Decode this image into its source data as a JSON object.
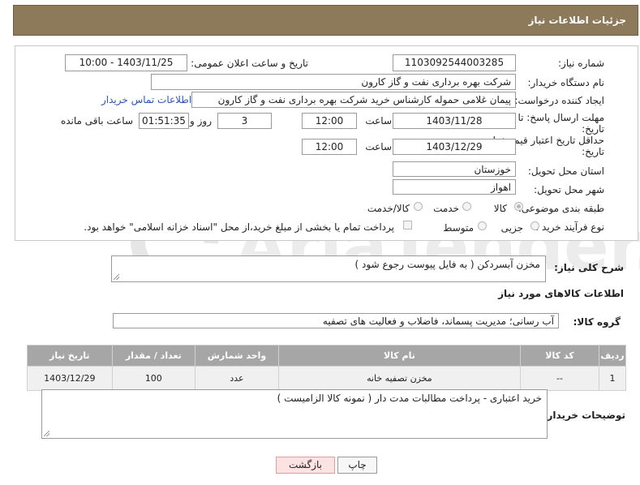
{
  "header": {
    "title": "جزئیات اطلاعات نیاز"
  },
  "form": {
    "need_number": {
      "label": "شماره نیاز:",
      "value": "1103092544003285"
    },
    "announce_datetime": {
      "label": "تاریخ و ساعت اعلان عمومی:",
      "value": "1403/11/25 - 10:00"
    },
    "buyer_org": {
      "label": "نام دستگاه خریدار:",
      "value": "شرکت بهره برداری نفت و گاز کارون"
    },
    "creator": {
      "label": "ایجاد کننده درخواست:",
      "value": "پیمان غلامی حموله کارشناس خرید شرکت بهره برداری نفت و گاز کارون",
      "link": "اطلاعات تماس خریدار"
    },
    "reply_deadline": {
      "label_line1": "مهلت ارسال پاسخ: تا",
      "label_line2": "تاریخ:",
      "date": "1403/11/28",
      "time_label": "ساعت",
      "time": "12:00",
      "days": "3",
      "days_label": "روز و",
      "remaining": "01:51:35",
      "remaining_label": "ساعت باقی مانده"
    },
    "price_validity": {
      "label_line1": "حداقل تاریخ اعتبار قیمت: تا",
      "label_line2": "تاریخ:",
      "date": "1403/12/29",
      "time_label": "ساعت",
      "time": "12:00"
    },
    "province": {
      "label": "استان محل تحویل:",
      "value": "خوزستان"
    },
    "city": {
      "label": "شهر محل تحویل:",
      "value": "اهواز"
    },
    "category": {
      "label": "طبقه بندی موضوعی:",
      "options": [
        "کالا",
        "خدمت",
        "کالا/خدمت"
      ],
      "selected": "کالا"
    },
    "process_type": {
      "label": "نوع فرآیند خرید :",
      "options": [
        "جزیی",
        "متوسط"
      ],
      "note": "پرداخت تمام یا بخشی از مبلغ خرید،از محل \"اسناد خزانه اسلامی\" خواهد بود."
    }
  },
  "summary": {
    "label": "شرح کلی نیاز:",
    "value": "مخزن آبسردکن ( به فایل پیوست رجوع شود )"
  },
  "goods_info_title": "اطلاعات کالاهای مورد نیاز",
  "goods_group": {
    "label": "گروه کالا:",
    "value": "آب رسانی؛ مدیریت پسماند، فاضلاب و فعالیت های تصفیه"
  },
  "table": {
    "headers": [
      "ردیف",
      "کد کالا",
      "نام کالا",
      "واحد شمارش",
      "تعداد / مقدار",
      "تاریخ نیاز"
    ],
    "rows": [
      [
        "1",
        "--",
        "مخزن تصفیه خانه",
        "عدد",
        "100",
        "1403/12/29"
      ]
    ]
  },
  "buyer_notes": {
    "label": "توضیحات خریدار:",
    "value": "خرید اعتباری - پرداخت مطالبات مدت دار ( نمونه کالا الزامیست )"
  },
  "buttons": {
    "print": "چاپ",
    "back": "بازگشت"
  },
  "watermark": "AriaTender.neT",
  "colors": {
    "header": "#8c7a5a",
    "link": "#2a55b8",
    "table_header": "#a6a6a6",
    "back_button": "#fbe3e3"
  }
}
